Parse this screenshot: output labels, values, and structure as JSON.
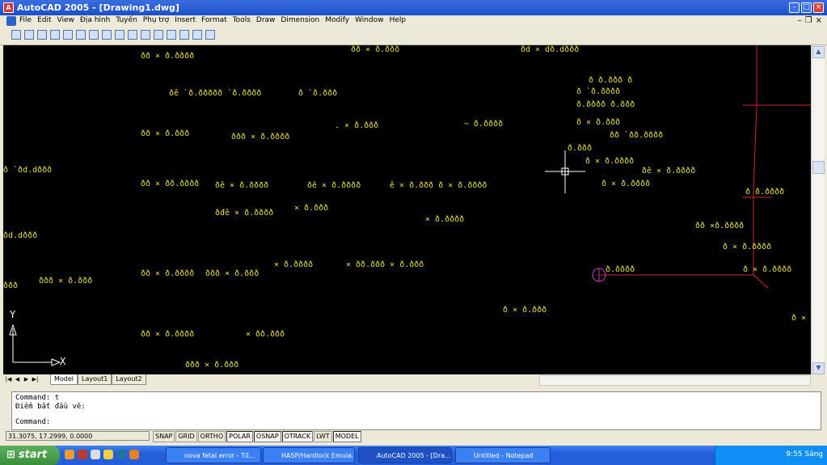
{
  "window": {
    "title": "AutoCAD 2005 - [Drawing1.dwg]",
    "icon": "autocad-icon"
  },
  "menu": [
    "File",
    "Edit",
    "View",
    "Địa hình",
    "Tuyến",
    "Phụ trợ",
    "Insert",
    "Format",
    "Tools",
    "Draw",
    "Dimension",
    "Modify",
    "Window",
    "Help"
  ],
  "labels": [
    {
      "t": "ðð × ð.ðððð"
    },
    {
      "t": "ðð × ð.ððð"
    },
    {
      "t": "ðd × dð.dððð"
    },
    {
      "t": "ðê `ð.ððððð `ð.ðððð"
    },
    {
      "t": "ð `ð.ððð"
    },
    {
      "t": "ðð × ð.ððð"
    },
    {
      "t": "ððð × ð.ðððð"
    },
    {
      "t": ". × ð.ððð"
    },
    {
      "t": "~ ð.ðððð"
    },
    {
      "t": "ð `ðd.dððð"
    },
    {
      "t": "ðð × ðð.ðððð"
    },
    {
      "t": "ðê × ð.ðððð"
    },
    {
      "t": "ðê × ð.ðððð"
    },
    {
      "t": "ê × ð.ððð ð × ð.ðððð"
    },
    {
      "t": "ðđê × ð.ðððð"
    },
    {
      "t": "× ð.ððð"
    },
    {
      "t": "× ð.ðððð"
    },
    {
      "t": "ðd.dððð"
    },
    {
      "t": "ðð × ð.ðððð"
    },
    {
      "t": "ððð × ð.ððð"
    },
    {
      "t": "× ð.ðððð"
    },
    {
      "t": "× ðð.ððð × ð.ððð"
    },
    {
      "t": "ððð × ð.ððð"
    },
    {
      "t": "ððð"
    },
    {
      "t": "ðð × ð.ðððð"
    },
    {
      "t": "× ðð.ððð"
    },
    {
      "t": "ððð × ð.ððð"
    },
    {
      "t": "ð × ð.ððð"
    },
    {
      "t": "ð ð.ððð ð"
    },
    {
      "t": "ð `ð.ðððð"
    },
    {
      "t": "ð.ðððð ð.ððð"
    },
    {
      "t": "ð × ð.ððð"
    },
    {
      "t": "ðð `ðð.ðððð"
    },
    {
      "t": "ð.ððð"
    },
    {
      "t": "ð × ð.ðððð"
    },
    {
      "t": "ðê × ð.ðððð"
    },
    {
      "t": "ð × ð.ðððð"
    },
    {
      "t": "ð ð.ðððð"
    },
    {
      "t": "ðð ×ð.ðððð"
    },
    {
      "t": "ð × ð.ðððð"
    },
    {
      "t": "ð × ð.ðððð"
    },
    {
      "t": "ð.ðððð"
    },
    {
      "t": "ð ×"
    }
  ],
  "axis": {
    "x": "X",
    "y": "Y"
  },
  "layout_tabs": [
    {
      "label": "Model",
      "active": true
    },
    {
      "label": "Layout1",
      "active": false
    },
    {
      "label": "Layout2",
      "active": false
    }
  ],
  "command": {
    "line1": "Command: t",
    "line2": "Điểm bắt đầu vẽ:",
    "line3": "Command:"
  },
  "coordinates": "31.3075, 17.2999, 0.0000",
  "status_buttons": [
    {
      "label": "SNAP",
      "on": false
    },
    {
      "label": "GRID",
      "on": false
    },
    {
      "label": "ORTHO",
      "on": false
    },
    {
      "label": "POLAR",
      "on": true
    },
    {
      "label": "OSNAP",
      "on": true
    },
    {
      "label": "OTRACK",
      "on": true
    },
    {
      "label": "LWT",
      "on": false
    },
    {
      "label": "MODEL",
      "on": true
    }
  ],
  "taskbar": {
    "start": "start",
    "items": [
      {
        "label": "nova fetal error - Tố...",
        "active": false
      },
      {
        "label": "HASP/Hardlock Emula...",
        "active": false
      },
      {
        "label": "AutoCAD 2005 - [Dra...",
        "active": true
      },
      {
        "label": "Untitled - Notepad",
        "active": false
      }
    ],
    "clock": "9:55 Sáng"
  },
  "colors": {
    "canvas": "#000000",
    "text": "#e6e047",
    "line": "#d02828",
    "marker": "#c040c0"
  }
}
